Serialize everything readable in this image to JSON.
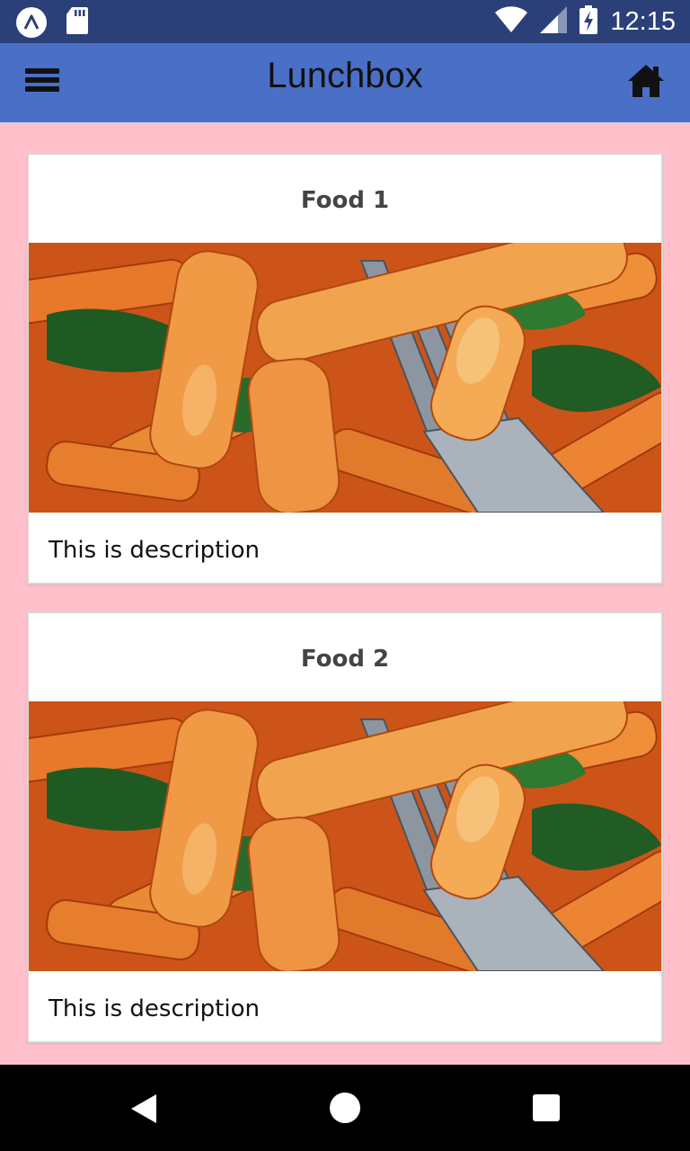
{
  "status_bar": {
    "time": "12:15",
    "icons": [
      "launcher-a-icon",
      "sd-card-icon",
      "wifi-icon",
      "signal-icon",
      "battery-charging-icon"
    ]
  },
  "app_bar": {
    "title": "Lunchbox",
    "menu_icon": "hamburger-menu-icon",
    "home_icon": "home-icon",
    "background_color": "#4a6fc7"
  },
  "page": {
    "background_color": "#ffc0cb"
  },
  "cards": [
    {
      "title": "Food 1",
      "image": "pasta-penne-photo",
      "description": "This is description"
    },
    {
      "title": "Food 2",
      "image": "pasta-penne-photo",
      "description": "This is description"
    }
  ],
  "nav_bar": {
    "icons": [
      "back-triangle-icon",
      "home-circle-icon",
      "recents-square-icon"
    ]
  }
}
